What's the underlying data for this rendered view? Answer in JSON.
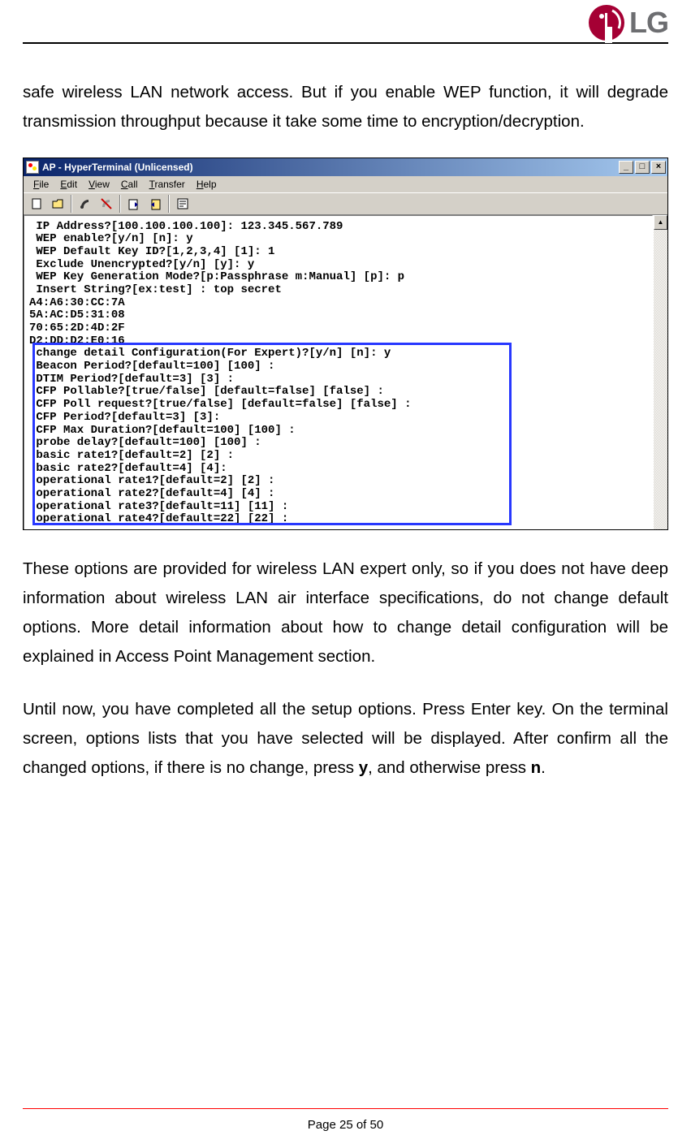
{
  "logo_text": "LG",
  "para1": "safe wireless LAN network access. But if you enable WEP function, it will degrade transmission throughput because it take some time to encryption/decryption.",
  "window": {
    "title": "AP - HyperTerminal (Unlicensed)",
    "menu": {
      "file": "File",
      "edit": "Edit",
      "view": "View",
      "call": "Call",
      "transfer": "Transfer",
      "help": "Help"
    },
    "win_btn_min": "_",
    "win_btn_max": "□",
    "win_btn_close": "×",
    "sb_up": "▲",
    "sb_dn": "▼",
    "term_top": [
      " IP Address?[100.100.100.100]: 123.345.567.789",
      " WEP enable?[y/n] [n]: y",
      " WEP Default Key ID?[1,2,3,4] [1]: 1",
      " Exclude Unencrypted?[y/n] [y]: y",
      " WEP Key Generation Mode?[p:Passphrase m:Manual] [p]: p",
      " Insert String?[ex:test] : top secret",
      "A4:A6:30:CC:7A",
      "5A:AC:D5:31:08",
      "70:65:2D:4D:2F",
      "D2:DD:D2:E0:16"
    ],
    "term_box": [
      " change detail Configuration(For Expert)?[y/n] [n]: y",
      " Beacon Period?[default=100] [100] :",
      " DTIM Period?[default=3] [3] :",
      " CFP Pollable?[true/false] [default=false] [false] :",
      " CFP Poll request?[true/false] [default=false] [false] :",
      " CFP Period?[default=3] [3]:",
      " CFP Max Duration?[default=100] [100] :",
      " probe delay?[default=100] [100] :",
      " basic rate1?[default=2] [2] :",
      " basic rate2?[default=4] [4]:",
      " operational rate1?[default=2] [2] :",
      " operational rate2?[default=4] [4] :",
      " operational rate3?[default=11] [11] :",
      " operational rate4?[default=22] [22] :"
    ]
  },
  "para2": "These options are provided for wireless LAN expert only, so if you does not have deep information about wireless LAN air interface specifications, do not change default options. More detail information about how to change detail configuration will be explained in Access Point Management section.",
  "para3_a": "Until now, you have completed all the setup options. Press Enter key. On the terminal screen, options lists that you have selected will be displayed. After confirm all the changed options, if there is no change, press ",
  "para3_y": "y",
  "para3_b": ", and otherwise press ",
  "para3_n": "n",
  "para3_c": ".",
  "footer": "Page 25 of 50"
}
